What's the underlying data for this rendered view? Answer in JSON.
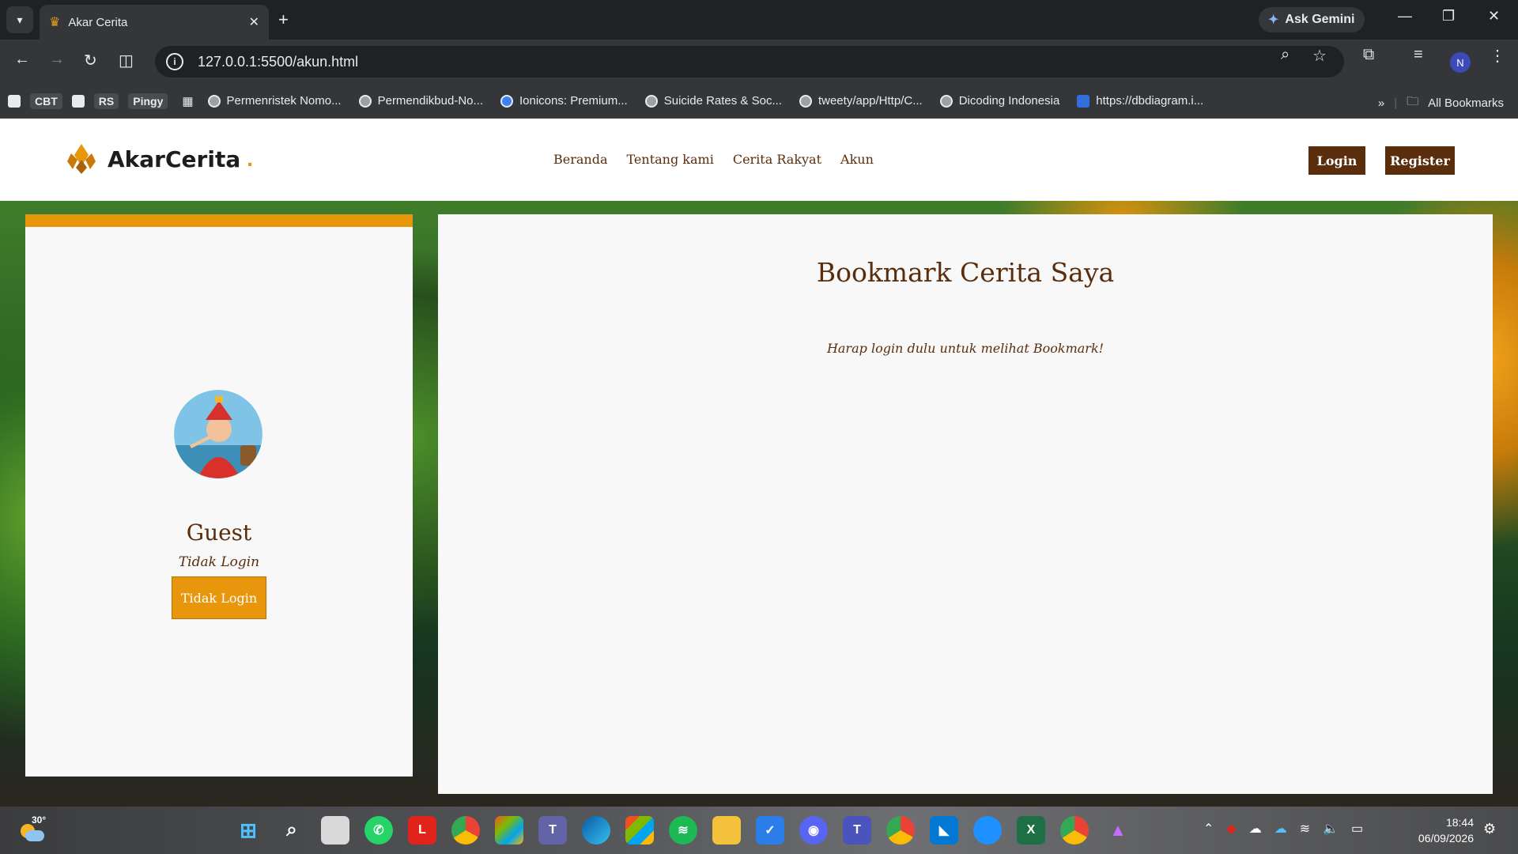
{
  "browser": {
    "tab_title": "Akar Cerita",
    "url": "127.0.0.1:5500/akun.html",
    "ask_gemini": "Ask Gemini",
    "profile_initial": "N",
    "bookmarks": [
      {
        "label": "CBT",
        "icon": "chip"
      },
      {
        "label": "RS",
        "icon": "chip"
      },
      {
        "label": "Pingy",
        "icon": "chip"
      },
      {
        "label": "Permenristek Nomo...",
        "icon": "globe-icon"
      },
      {
        "label": "Permendikbud-No...",
        "icon": "globe-icon"
      },
      {
        "label": "Ionicons: Premium...",
        "icon": "ionicons-icon"
      },
      {
        "label": "Suicide Rates & Soc...",
        "icon": "globe-icon"
      },
      {
        "label": "tweety/app/Http/C...",
        "icon": "globe-icon"
      },
      {
        "label": "Dicoding Indonesia",
        "icon": "globe-icon"
      },
      {
        "label": "https://dbdiagram.i...",
        "icon": "dbdiagram-icon"
      }
    ],
    "all_bookmarks": "All Bookmarks"
  },
  "site": {
    "brand": "AkarCerita",
    "brand_dot": ".",
    "nav": [
      "Beranda",
      "Tentang kami",
      "Cerita Rakyat",
      "Akun"
    ],
    "login_label": "Login",
    "register_label": "Register"
  },
  "profile": {
    "name": "Guest",
    "status": "Tidak Login",
    "button_label": "Tidak Login"
  },
  "bookmark_panel": {
    "title": "Bookmark Cerita Saya",
    "message": "Harap login dulu untuk melihat Bookmark!"
  },
  "taskbar": {
    "temperature": "30°",
    "time": "18:44",
    "date": "06/09/2026"
  },
  "colors": {
    "brand_brown": "#5a2d0c",
    "accent_orange": "#e8960c"
  }
}
